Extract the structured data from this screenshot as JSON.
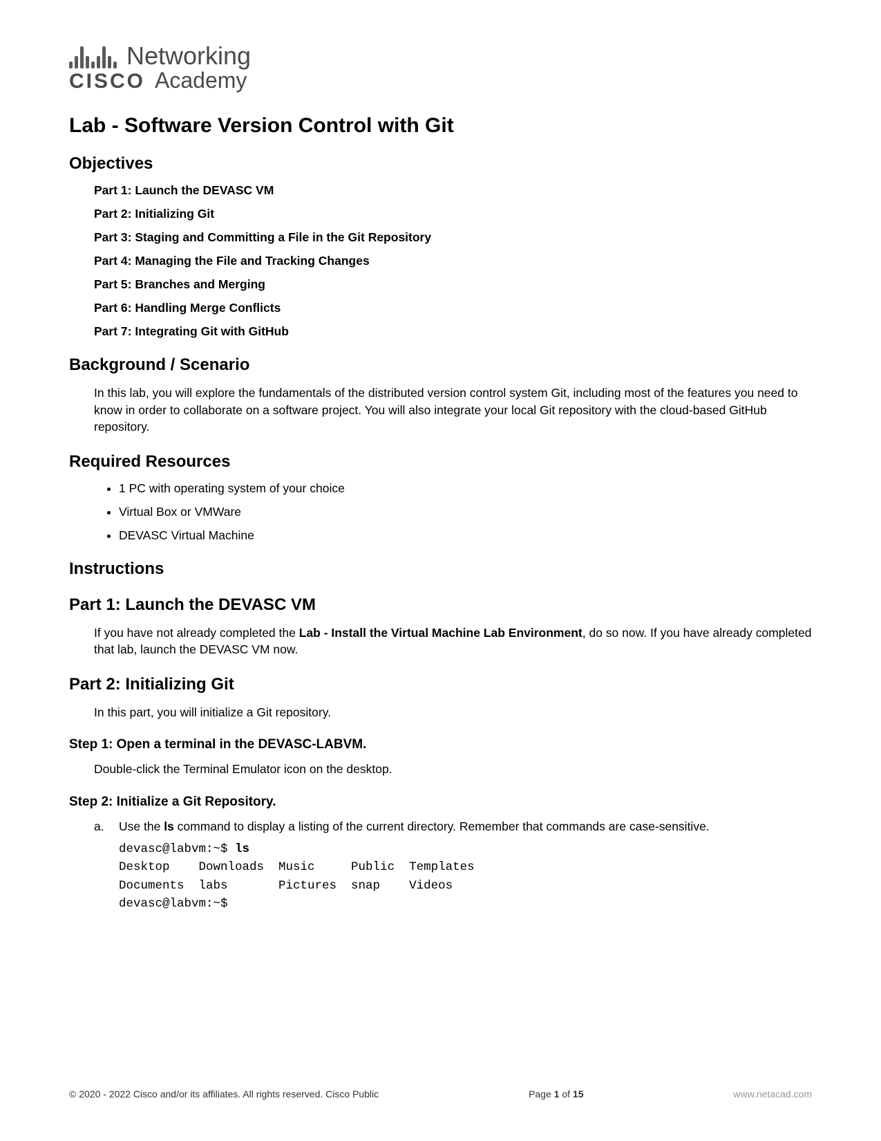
{
  "logo": {
    "top_word": "Networking",
    "cisco_word": "CISCO",
    "bottom_word": "Academy"
  },
  "title": "Lab - Software Version Control with Git",
  "sections": {
    "objectives_header": "Objectives",
    "objectives": [
      "Part 1: Launch the DEVASC VM",
      "Part 2: Initializing Git",
      "Part 3: Staging and Committing a File in the Git Repository",
      "Part 4: Managing the File and Tracking Changes",
      "Part 5: Branches and Merging",
      "Part 6: Handling Merge Conflicts",
      "Part 7: Integrating Git with GitHub"
    ],
    "background_header": "Background / Scenario",
    "background_text": "In this lab, you will explore the fundamentals of the distributed version control system Git, including most of the features you need to know in order to collaborate on a software project. You will also integrate your local Git repository with the cloud-based GitHub repository.",
    "resources_header": "Required Resources",
    "resources": [
      "1 PC with operating system of your choice",
      "Virtual Box or VMWare",
      "DEVASC Virtual Machine"
    ],
    "instructions_header": "Instructions",
    "part1_header": "Part 1: Launch the DEVASC VM",
    "part1_text_pre": "If you have not already completed the ",
    "part1_bold": "Lab - Install the Virtual Machine Lab Environment",
    "part1_text_post": ", do so now. If you have already completed that lab, launch the DEVASC VM now.",
    "part2_header": "Part 2: Initializing Git",
    "part2_text": "In this part, you will initialize a Git repository.",
    "step1_header": "Step 1: Open a terminal in the DEVASC-LABVM.",
    "step1_text": "Double-click the Terminal Emulator icon on the desktop.",
    "step2_header": "Step 2: Initialize a Git Repository.",
    "step2_letter": "a.",
    "step2_a_pre": "Use the ",
    "step2_a_cmd": "ls",
    "step2_a_post": " command to display a listing of the current directory. Remember that commands are case-sensitive.",
    "code": {
      "prompt1": "devasc@labvm:~$ ",
      "cmd1": "ls",
      "line2": "Desktop    Downloads  Music     Public  Templates",
      "line3": "Documents  labs       Pictures  snap    Videos",
      "prompt2": "devasc@labvm:~$"
    }
  },
  "footer": {
    "copyright": "© 2020 - 2022 Cisco and/or its affiliates. All rights reserved. Cisco Public",
    "page_pre": "Page ",
    "page_num": "1",
    "page_mid": " of ",
    "page_total": "15",
    "url": "www.netacad.com"
  }
}
